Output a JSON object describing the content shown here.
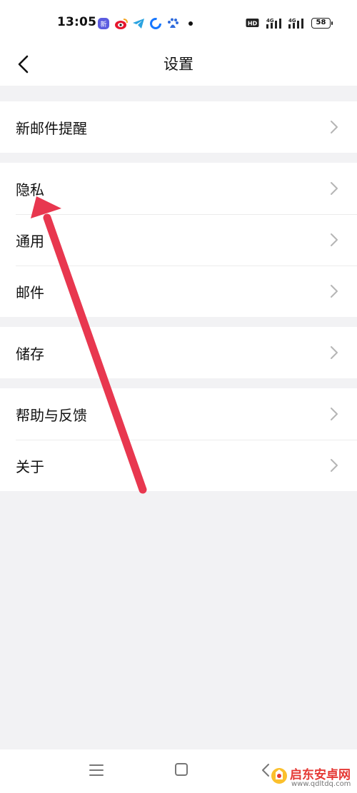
{
  "status_bar": {
    "time": "13:05",
    "notification_icons": [
      "app-icon",
      "weibo-icon",
      "telegram-icon",
      "browser-icon",
      "baidu-icon"
    ],
    "network_hd": "HD",
    "network_1": "4G",
    "network_2": "4G",
    "battery": "58"
  },
  "header": {
    "title": "设置"
  },
  "groups": [
    {
      "items": [
        {
          "label": "新邮件提醒"
        }
      ]
    },
    {
      "items": [
        {
          "label": "隐私"
        },
        {
          "label": "通用"
        },
        {
          "label": "邮件"
        }
      ]
    },
    {
      "items": [
        {
          "label": "储存"
        }
      ]
    },
    {
      "items": [
        {
          "label": "帮助与反馈"
        },
        {
          "label": "关于"
        }
      ]
    }
  ],
  "annotation": {
    "color": "#e8374f"
  },
  "watermark": {
    "title": "启东安卓网",
    "url": "www.qdltdq.com"
  },
  "colors": {
    "background": "#f2f2f4",
    "surface": "#ffffff",
    "text": "#111111",
    "chevron": "#b5b5b5"
  }
}
